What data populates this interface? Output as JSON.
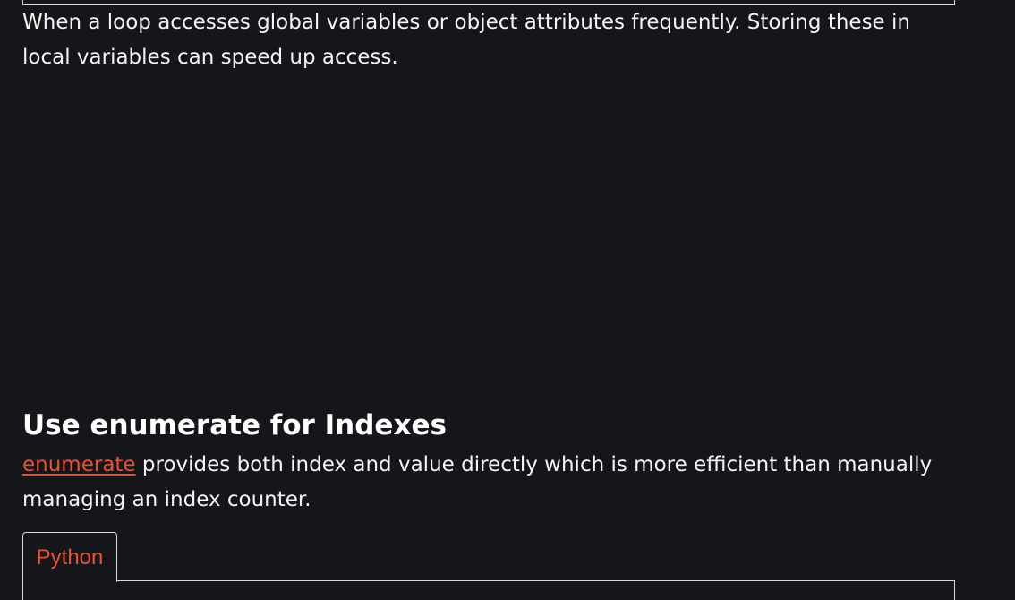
{
  "section_1": {
    "paragraph": "When a loop accesses global variables or object attributes frequently. Storing these in local variables can speed up access."
  },
  "section_2": {
    "heading": "Use enumerate for Indexes",
    "link_text": "enumerate",
    "paragraph_rest": " provides both index and value directly which is more efficient than manually managing an index counter."
  },
  "code_tabs": [
    {
      "label": "Python",
      "active": true
    }
  ],
  "colors": {
    "background": "#151619",
    "text": "#f4f4f4",
    "accent": "#e8522c",
    "border": "#d9d9d9"
  }
}
